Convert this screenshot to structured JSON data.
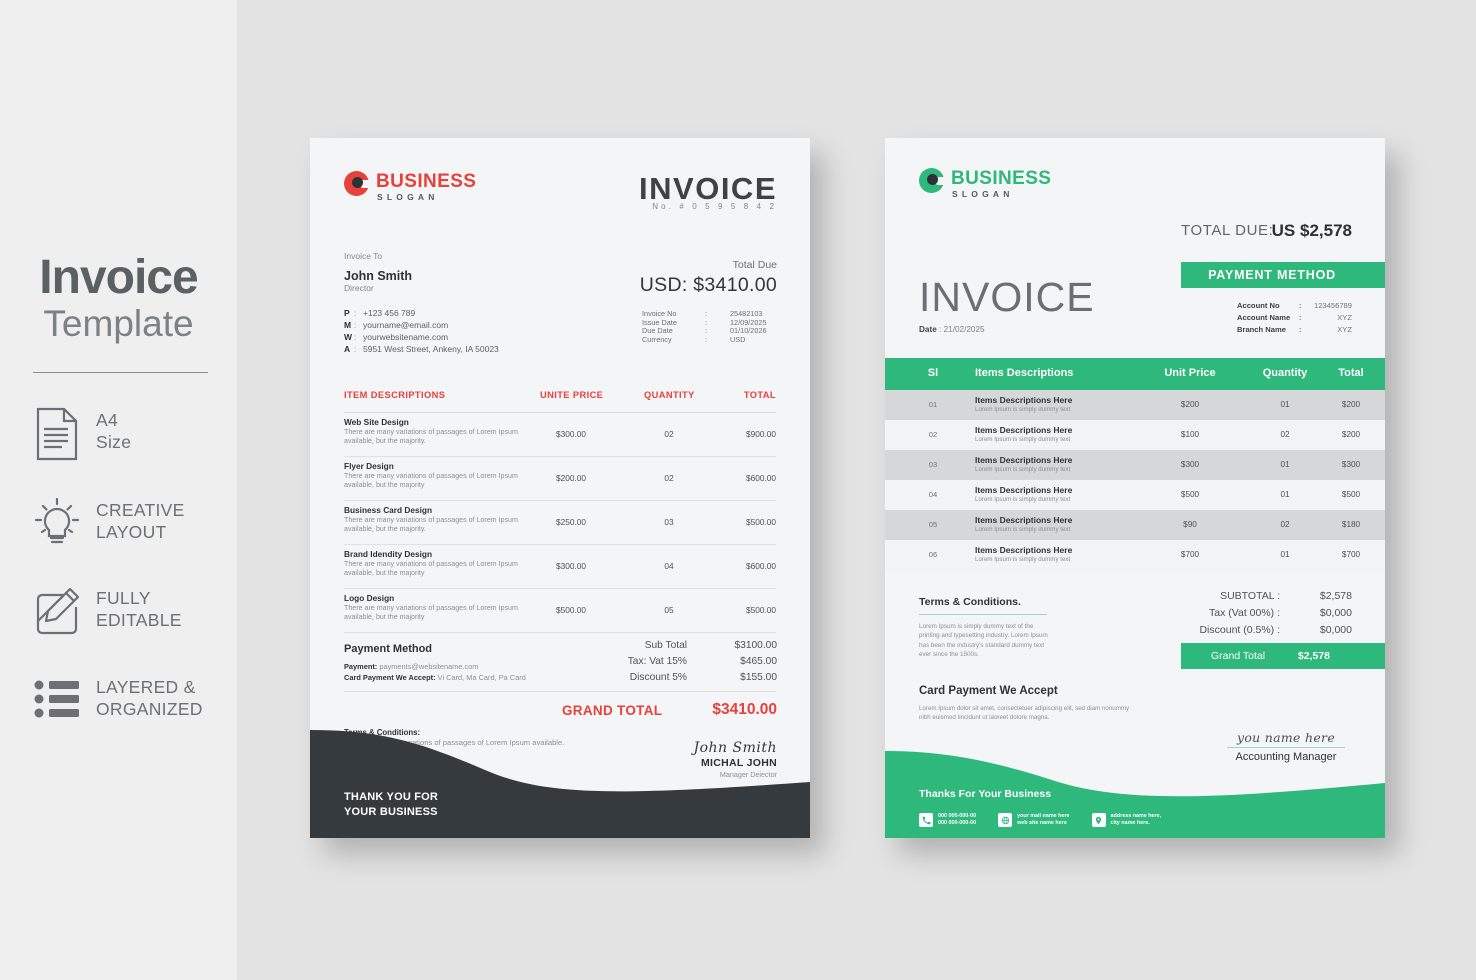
{
  "promo": {
    "title": "Invoice",
    "subtitle": "Template",
    "features": [
      {
        "icon": "document-icon",
        "label": "A4\nSize"
      },
      {
        "icon": "lightbulb-icon",
        "label": "CREATIVE\nLAYOUT"
      },
      {
        "icon": "pencil-edit-icon",
        "label": "FULLY\nEDITABLE"
      },
      {
        "icon": "list-layers-icon",
        "label": "LAYERED &\nORGANIZED"
      }
    ]
  },
  "colors": {
    "red": "#E8413C",
    "green": "#2EB87C",
    "dark": "#343A3D",
    "page": "#F4F5F7",
    "background": "#E3E3E3",
    "promo_background": "#EFEFEF"
  },
  "invoice_red": {
    "logo": {
      "name": "BUSINESS",
      "slogan": "SLOGAN"
    },
    "title": "INVOICE",
    "number_line": "No.  #  0 5 9 5 8 4 2",
    "invoice_to_label": "Invoice To",
    "client_name": "John Smith",
    "client_role": "Director",
    "contacts": [
      {
        "key": "P",
        "value": "+123 456 789"
      },
      {
        "key": "M",
        "value": "yourname@email.com"
      },
      {
        "key": "W",
        "value": "yourwebsitename.com"
      },
      {
        "key": "A",
        "value": "5951 West Street, Ankeny, IA 50023"
      }
    ],
    "total_due_label": "Total Due",
    "total_due_value": "USD: $3410.00",
    "meta": [
      {
        "key": "Invoice No",
        "value": "25482103"
      },
      {
        "key": "Issue Date",
        "value": "12/09/2025"
      },
      {
        "key": "Due Date",
        "value": "01/10/2026"
      },
      {
        "key": "Currency",
        "value": "USD"
      }
    ],
    "table_headers": {
      "item": "ITEM DESCRIPTIONS",
      "price": "UNITE PRICE",
      "quantity": "QUANTITY",
      "total": "TOTAL"
    },
    "items": [
      {
        "name": "Web Site Design",
        "desc": "There are many variations of passages of Lorem Ipsum available, but the majority.",
        "price": "$300.00",
        "qty": "02",
        "total": "$900.00"
      },
      {
        "name": "Flyer Design",
        "desc": "There are many variations of passages of Lorem Ipsum available, but the majority",
        "price": "$200.00",
        "qty": "02",
        "total": "$600.00"
      },
      {
        "name": "Business Card Design",
        "desc": "There are many variations of passages of Lorem Ipsum available, but the majority.",
        "price": "$250.00",
        "qty": "03",
        "total": "$500.00"
      },
      {
        "name": "Brand Idendity Design",
        "desc": "There are many variations of passages of Lorem Ipsum available, but the majority",
        "price": "$300.00",
        "qty": "04",
        "total": "$600.00"
      },
      {
        "name": "Logo Design",
        "desc": "There are many variations of passages of Lorem Ipsum available, but the majority",
        "price": "$500.00",
        "qty": "05",
        "total": "$500.00"
      }
    ],
    "payment_title": "Payment Method",
    "payment_email_label": "Payment:",
    "payment_email": "payments@websitename.com",
    "payment_cards_label": "Card Payment We Accept:",
    "payment_cards": "Vi Card, Ma Card, Pa Card",
    "summary": [
      {
        "label": "Sub Total",
        "value": "$3100.00"
      },
      {
        "label": "Tax: Vat 15%",
        "value": "$465.00"
      },
      {
        "label": "Discount 5%",
        "value": "$155.00"
      }
    ],
    "grand_total_label": "GRAND TOTAL",
    "grand_total_value": "$3410.00",
    "terms_title": "Terms & Conditions:",
    "terms_body": "There are many variations of passages of Lorem Ipsum available.",
    "signature_script": "John Smith",
    "signature_name": "MICHAL JOHN",
    "signature_role": "Manager Deiector",
    "footer_thanks_line1": "THANK YOU FOR",
    "footer_thanks_line2": "YOUR BUSINESS"
  },
  "invoice_green": {
    "logo": {
      "name": "BUSINESS",
      "slogan": "SLOGAN"
    },
    "total_due_label": "TOTAL DUE:",
    "total_due_value": "US $2,578",
    "payment_method_button": "PAYMENT METHOD",
    "account": [
      {
        "key": "Account No",
        "colon": ":",
        "value": "123456789"
      },
      {
        "key": "Account Name",
        "colon": ":",
        "value": "XYZ"
      },
      {
        "key": "Branch Name",
        "colon": ":",
        "value": "XYZ"
      }
    ],
    "title": "INVOICE",
    "date_label": "Date",
    "date_colon": ":",
    "date_value": "21/02/2025",
    "table_headers": {
      "sl": "Sl",
      "item": "Items Descriptions",
      "price": "Unit Price",
      "quantity": "Quantity",
      "total": "Total"
    },
    "items": [
      {
        "sl": "01",
        "name": "Items Descriptions Here",
        "desc": "Lorem Ipsum is simply dummy text",
        "price": "$200",
        "qty": "01",
        "total": "$200"
      },
      {
        "sl": "02",
        "name": "Items Descriptions Here",
        "desc": "Lorem Ipsum is simply dummy text",
        "price": "$100",
        "qty": "02",
        "total": "$200"
      },
      {
        "sl": "03",
        "name": "Items Descriptions Here",
        "desc": "Lorem Ipsum is simply dummy text",
        "price": "$300",
        "qty": "01",
        "total": "$300"
      },
      {
        "sl": "04",
        "name": "Items Descriptions Here",
        "desc": "Lorem Ipsum is simply dummy text",
        "price": "$500",
        "qty": "01",
        "total": "$500"
      },
      {
        "sl": "05",
        "name": "Items Descriptions Here",
        "desc": "Lorem Ipsum is simply dummy text",
        "price": "$90",
        "qty": "02",
        "total": "$180"
      },
      {
        "sl": "06",
        "name": "Items Descriptions Here",
        "desc": "Lorem Ipsum is simply dummy text",
        "price": "$700",
        "qty": "01",
        "total": "$700"
      }
    ],
    "terms_title": "Terms & Conditions.",
    "terms_body": "Lorem Ipsum is simply dummy text of the printing and typesetting industry. Lorem Ipsum has been the industry's standard dummy text ever since the 1500s.",
    "card_title": "Card Payment We Accept",
    "card_body": "Lorem Ipsum dolor sit amet, consectetuer adipiscing elit, sed diam nonummy nibh euismod tincidunt ut laoreet dolore magna.",
    "summary": [
      {
        "label": "SUBTOTAL :",
        "value": "$2,578"
      },
      {
        "label": "Tax (Vat 00%) :",
        "value": "$0,000"
      },
      {
        "label": "Discount (0.5%) :",
        "value": "$0,000"
      }
    ],
    "grand_total_label": "Grand Total",
    "grand_total_value": "$2,578",
    "signature_script": "you name here",
    "signature_role": "Accounting Manager",
    "footer_thanks": "Thanks For Your Business",
    "footer_contacts": [
      {
        "icon": "phone-icon",
        "line1": "000 000-000-00",
        "line2": "000 000-000-00"
      },
      {
        "icon": "globe-mail-icon",
        "line1": "your mail name here",
        "line2": "web site name here"
      },
      {
        "icon": "location-pin-icon",
        "line1": "address name here,",
        "line2": "city name here."
      }
    ]
  }
}
